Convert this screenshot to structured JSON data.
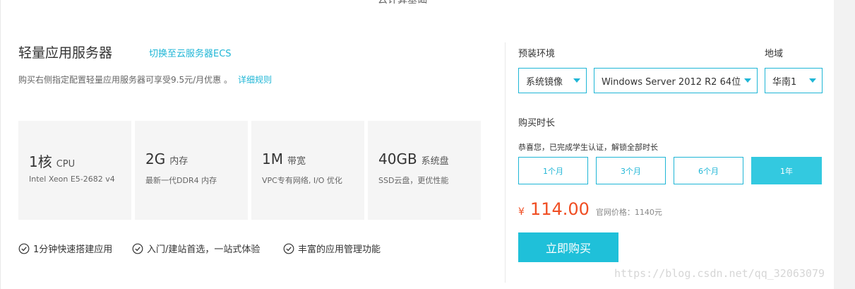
{
  "header": {
    "title": "云计算基础"
  },
  "product": {
    "title": "轻量应用服务器",
    "switch_link": "切换至云服务器ECS",
    "promo_text": "购买右侧指定配置轻量应用服务器可享受9.5元/月优惠 。",
    "promo_link": "详细规则"
  },
  "specs": [
    {
      "value": "1核",
      "unit": "CPU",
      "desc": "Intel Xeon E5-2682 v4"
    },
    {
      "value": "2G",
      "unit": "内存",
      "desc": "最新一代DDR4 内存"
    },
    {
      "value": "1M",
      "unit": "带宽",
      "desc": "VPC专有网络, I/O 优化"
    },
    {
      "value": "40GB",
      "unit": "系统盘",
      "desc": "SSD云盘，更优性能"
    }
  ],
  "features": [
    "1分钟快速搭建应用",
    "入门/建站首选，一站式体验",
    "丰富的应用管理功能"
  ],
  "config": {
    "env_label": "预装环境",
    "region_label": "地域",
    "image_type": "系统镜像",
    "os": "Windows Server 2012 R2 64位",
    "region": "华南1",
    "duration_label": "购买时长",
    "notice": "恭喜您，已完成学生认证，解锁全部时长",
    "durations": [
      "1个月",
      "3个月",
      "6个月",
      "1年"
    ],
    "selected_duration": "1年"
  },
  "pricing": {
    "currency": "¥",
    "price": "114.00",
    "original": "官网价格：1140元"
  },
  "buy_label": "立即购买",
  "watermark": "https://blog.csdn.net/qq_32063079",
  "colors": {
    "accent": "#1fb6d6",
    "price": "#f04e23",
    "button": "#1fc0d9"
  }
}
